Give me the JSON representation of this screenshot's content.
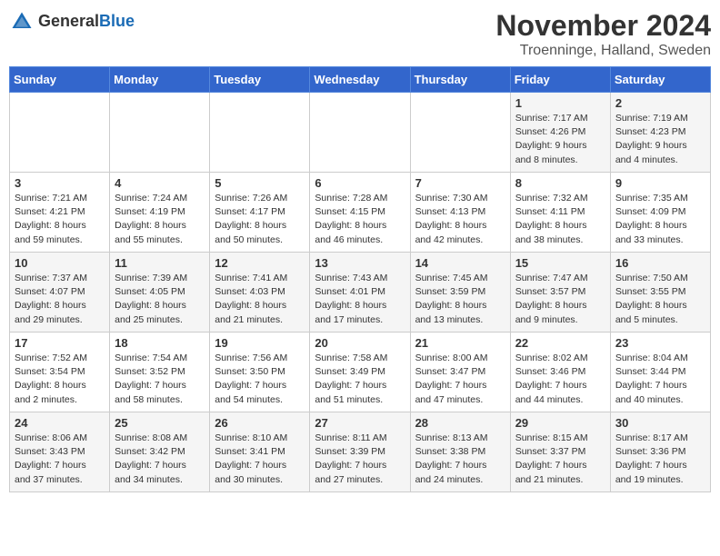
{
  "header": {
    "logo_general": "General",
    "logo_blue": "Blue",
    "month_year": "November 2024",
    "location": "Troenninge, Halland, Sweden"
  },
  "days_of_week": [
    "Sunday",
    "Monday",
    "Tuesday",
    "Wednesday",
    "Thursday",
    "Friday",
    "Saturday"
  ],
  "weeks": [
    [
      {
        "day": "",
        "sunrise": "",
        "sunset": "",
        "daylight": ""
      },
      {
        "day": "",
        "sunrise": "",
        "sunset": "",
        "daylight": ""
      },
      {
        "day": "",
        "sunrise": "",
        "sunset": "",
        "daylight": ""
      },
      {
        "day": "",
        "sunrise": "",
        "sunset": "",
        "daylight": ""
      },
      {
        "day": "",
        "sunrise": "",
        "sunset": "",
        "daylight": ""
      },
      {
        "day": "1",
        "sunrise": "Sunrise: 7:17 AM",
        "sunset": "Sunset: 4:26 PM",
        "daylight": "Daylight: 9 hours and 8 minutes."
      },
      {
        "day": "2",
        "sunrise": "Sunrise: 7:19 AM",
        "sunset": "Sunset: 4:23 PM",
        "daylight": "Daylight: 9 hours and 4 minutes."
      }
    ],
    [
      {
        "day": "3",
        "sunrise": "Sunrise: 7:21 AM",
        "sunset": "Sunset: 4:21 PM",
        "daylight": "Daylight: 8 hours and 59 minutes."
      },
      {
        "day": "4",
        "sunrise": "Sunrise: 7:24 AM",
        "sunset": "Sunset: 4:19 PM",
        "daylight": "Daylight: 8 hours and 55 minutes."
      },
      {
        "day": "5",
        "sunrise": "Sunrise: 7:26 AM",
        "sunset": "Sunset: 4:17 PM",
        "daylight": "Daylight: 8 hours and 50 minutes."
      },
      {
        "day": "6",
        "sunrise": "Sunrise: 7:28 AM",
        "sunset": "Sunset: 4:15 PM",
        "daylight": "Daylight: 8 hours and 46 minutes."
      },
      {
        "day": "7",
        "sunrise": "Sunrise: 7:30 AM",
        "sunset": "Sunset: 4:13 PM",
        "daylight": "Daylight: 8 hours and 42 minutes."
      },
      {
        "day": "8",
        "sunrise": "Sunrise: 7:32 AM",
        "sunset": "Sunset: 4:11 PM",
        "daylight": "Daylight: 8 hours and 38 minutes."
      },
      {
        "day": "9",
        "sunrise": "Sunrise: 7:35 AM",
        "sunset": "Sunset: 4:09 PM",
        "daylight": "Daylight: 8 hours and 33 minutes."
      }
    ],
    [
      {
        "day": "10",
        "sunrise": "Sunrise: 7:37 AM",
        "sunset": "Sunset: 4:07 PM",
        "daylight": "Daylight: 8 hours and 29 minutes."
      },
      {
        "day": "11",
        "sunrise": "Sunrise: 7:39 AM",
        "sunset": "Sunset: 4:05 PM",
        "daylight": "Daylight: 8 hours and 25 minutes."
      },
      {
        "day": "12",
        "sunrise": "Sunrise: 7:41 AM",
        "sunset": "Sunset: 4:03 PM",
        "daylight": "Daylight: 8 hours and 21 minutes."
      },
      {
        "day": "13",
        "sunrise": "Sunrise: 7:43 AM",
        "sunset": "Sunset: 4:01 PM",
        "daylight": "Daylight: 8 hours and 17 minutes."
      },
      {
        "day": "14",
        "sunrise": "Sunrise: 7:45 AM",
        "sunset": "Sunset: 3:59 PM",
        "daylight": "Daylight: 8 hours and 13 minutes."
      },
      {
        "day": "15",
        "sunrise": "Sunrise: 7:47 AM",
        "sunset": "Sunset: 3:57 PM",
        "daylight": "Daylight: 8 hours and 9 minutes."
      },
      {
        "day": "16",
        "sunrise": "Sunrise: 7:50 AM",
        "sunset": "Sunset: 3:55 PM",
        "daylight": "Daylight: 8 hours and 5 minutes."
      }
    ],
    [
      {
        "day": "17",
        "sunrise": "Sunrise: 7:52 AM",
        "sunset": "Sunset: 3:54 PM",
        "daylight": "Daylight: 8 hours and 2 minutes."
      },
      {
        "day": "18",
        "sunrise": "Sunrise: 7:54 AM",
        "sunset": "Sunset: 3:52 PM",
        "daylight": "Daylight: 7 hours and 58 minutes."
      },
      {
        "day": "19",
        "sunrise": "Sunrise: 7:56 AM",
        "sunset": "Sunset: 3:50 PM",
        "daylight": "Daylight: 7 hours and 54 minutes."
      },
      {
        "day": "20",
        "sunrise": "Sunrise: 7:58 AM",
        "sunset": "Sunset: 3:49 PM",
        "daylight": "Daylight: 7 hours and 51 minutes."
      },
      {
        "day": "21",
        "sunrise": "Sunrise: 8:00 AM",
        "sunset": "Sunset: 3:47 PM",
        "daylight": "Daylight: 7 hours and 47 minutes."
      },
      {
        "day": "22",
        "sunrise": "Sunrise: 8:02 AM",
        "sunset": "Sunset: 3:46 PM",
        "daylight": "Daylight: 7 hours and 44 minutes."
      },
      {
        "day": "23",
        "sunrise": "Sunrise: 8:04 AM",
        "sunset": "Sunset: 3:44 PM",
        "daylight": "Daylight: 7 hours and 40 minutes."
      }
    ],
    [
      {
        "day": "24",
        "sunrise": "Sunrise: 8:06 AM",
        "sunset": "Sunset: 3:43 PM",
        "daylight": "Daylight: 7 hours and 37 minutes."
      },
      {
        "day": "25",
        "sunrise": "Sunrise: 8:08 AM",
        "sunset": "Sunset: 3:42 PM",
        "daylight": "Daylight: 7 hours and 34 minutes."
      },
      {
        "day": "26",
        "sunrise": "Sunrise: 8:10 AM",
        "sunset": "Sunset: 3:41 PM",
        "daylight": "Daylight: 7 hours and 30 minutes."
      },
      {
        "day": "27",
        "sunrise": "Sunrise: 8:11 AM",
        "sunset": "Sunset: 3:39 PM",
        "daylight": "Daylight: 7 hours and 27 minutes."
      },
      {
        "day": "28",
        "sunrise": "Sunrise: 8:13 AM",
        "sunset": "Sunset: 3:38 PM",
        "daylight": "Daylight: 7 hours and 24 minutes."
      },
      {
        "day": "29",
        "sunrise": "Sunrise: 8:15 AM",
        "sunset": "Sunset: 3:37 PM",
        "daylight": "Daylight: 7 hours and 21 minutes."
      },
      {
        "day": "30",
        "sunrise": "Sunrise: 8:17 AM",
        "sunset": "Sunset: 3:36 PM",
        "daylight": "Daylight: 7 hours and 19 minutes."
      }
    ]
  ]
}
